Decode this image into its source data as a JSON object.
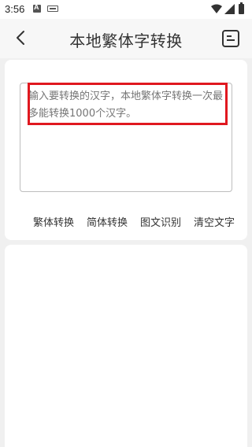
{
  "status_bar": {
    "time": "3:56",
    "icons": [
      "a-notification-icon",
      "keyboard-icon",
      "wifi-icon",
      "signal-icon",
      "battery-icon"
    ]
  },
  "header": {
    "title": "本地繁体字转换",
    "back_icon": "back-arrow-icon",
    "menu_icon": "document-list-icon"
  },
  "input": {
    "placeholder": "输入要转换的汉字，本地繁体字转换一次最多能转换1000个汉字。",
    "value": ""
  },
  "actions": {
    "traditional": "繁体转换",
    "simplified": "简体转换",
    "ocr": "图文识别",
    "clear": "清空文字"
  },
  "colors": {
    "highlight": "#e0181f",
    "background": "#f0f0f0",
    "card": "#ffffff"
  }
}
